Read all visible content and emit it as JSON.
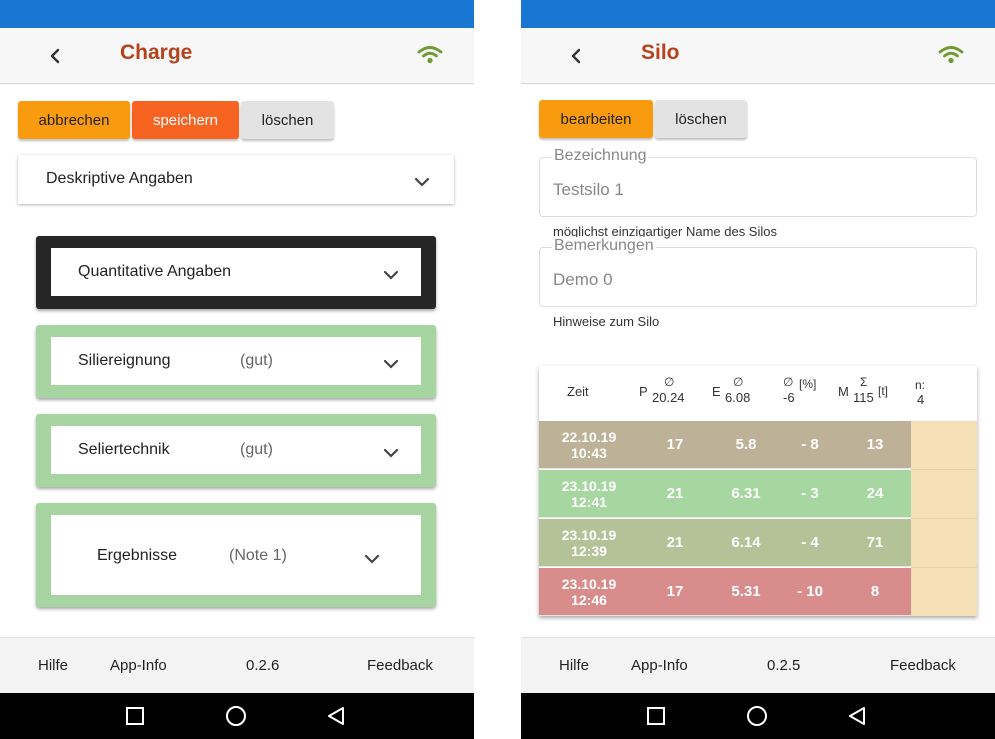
{
  "left": {
    "title": "Charge",
    "buttons": {
      "cancel": "abbrechen",
      "save": "speichern",
      "delete": "löschen"
    },
    "sections": {
      "descriptive": "Deskriptive Angaben",
      "quantitative": "Quantitative Angaben",
      "suitability": {
        "label": "Siliereignung",
        "status": "(gut)"
      },
      "sealing": {
        "label": "Seliertechnik",
        "status": "(gut)"
      },
      "results": {
        "label": "Ergebnisse",
        "status": "(Note 1)"
      }
    },
    "footer": {
      "help": "Hilfe",
      "info": "App-Info",
      "version": "0.2.6",
      "feedback": "Feedback"
    }
  },
  "right": {
    "title": "Silo",
    "buttons": {
      "edit": "bearbeiten",
      "delete": "löschen"
    },
    "name_field": {
      "label": "Bezeichnung",
      "value": "Testsilo 1",
      "help": "möglichst einzigartiger Name des Silos"
    },
    "notes_field": {
      "label": "Bemerkungen",
      "value": "Demo 0",
      "help": "Hinweise zum Silo"
    },
    "table": {
      "headers": {
        "time": "Zeit",
        "p": {
          "main": "P",
          "sym": "∅",
          "val": "20.24"
        },
        "e": {
          "main": "E",
          "sym": "∅",
          "val": "6.08"
        },
        "d": {
          "sym": "∅",
          "unit": "[%]",
          "val": "-6"
        },
        "m": {
          "main": "M",
          "sym": "Σ",
          "val": "115",
          "unit": "[t]"
        },
        "n": {
          "main": "n:",
          "val": "4"
        }
      },
      "rows": [
        {
          "date": "22.10.19",
          "time": "10:43",
          "p": "17",
          "e": "5.8",
          "d": "- 8",
          "m": "13",
          "color": "#bdb298"
        },
        {
          "date": "23.10.19",
          "time": "12:41",
          "p": "21",
          "e": "6.31",
          "d": "- 3",
          "m": "24",
          "color": "#a6d7a0"
        },
        {
          "date": "23.10.19",
          "time": "12:39",
          "p": "21",
          "e": "6.14",
          "d": "- 4",
          "m": "71",
          "color": "#b3c397"
        },
        {
          "date": "23.10.19",
          "time": "12:46",
          "p": "17",
          "e": "5.31",
          "d": "- 10",
          "m": "8",
          "color": "#d98c8c"
        }
      ]
    },
    "footer": {
      "help": "Hilfe",
      "info": "App-Info",
      "version": "0.2.5",
      "feedback": "Feedback"
    }
  },
  "colors": {
    "statusbar": "#1976d2",
    "title": "#b5411d",
    "wifi": "#6f9a31",
    "orange": "#f99b0f",
    "red": "#f76321",
    "green": "#a6d5a2"
  }
}
